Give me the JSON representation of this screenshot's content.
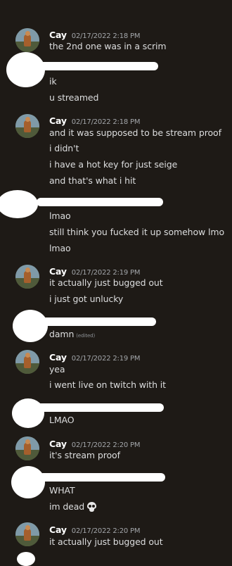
{
  "user": {
    "name": "Cay"
  },
  "groups": [
    {
      "time": "02/17/2022 2:18 PM",
      "lines": [
        "the 2nd one was in a scrim"
      ]
    },
    {
      "lines": [
        "ik",
        "u streamed"
      ]
    },
    {
      "time": "02/17/2022 2:18 PM",
      "lines": [
        "and it was supposed to be stream proof",
        "i didn't",
        "i have a hot key for just seige",
        "and that's what i hit"
      ]
    },
    {
      "lines": [
        "lmao",
        "still think you fucked it up somehow lmo",
        "lmao"
      ]
    },
    {
      "time": "02/17/2022 2:19 PM",
      "lines": [
        "it actually just bugged out",
        "i just got unlucky"
      ]
    },
    {
      "lines": [
        "damn"
      ],
      "edited": "(edited)"
    },
    {
      "time": "02/17/2022 2:19 PM",
      "lines": [
        "yea",
        "i went live on twitch with it"
      ]
    },
    {
      "lines": [
        "LMAO"
      ]
    },
    {
      "time": "02/17/2022 2:20 PM",
      "lines": [
        "it's stream proof"
      ]
    },
    {
      "lines": [
        "WHAT",
        "im dead"
      ],
      "emoji": "skull-icon"
    },
    {
      "time": "02/17/2022 2:20 PM",
      "lines": [
        "it actually just bugged out"
      ]
    }
  ],
  "colors": {
    "background": "#1e1a16",
    "text": "#dcddde",
    "timestamp": "#a3a6aa",
    "redaction": "#ffffff"
  }
}
